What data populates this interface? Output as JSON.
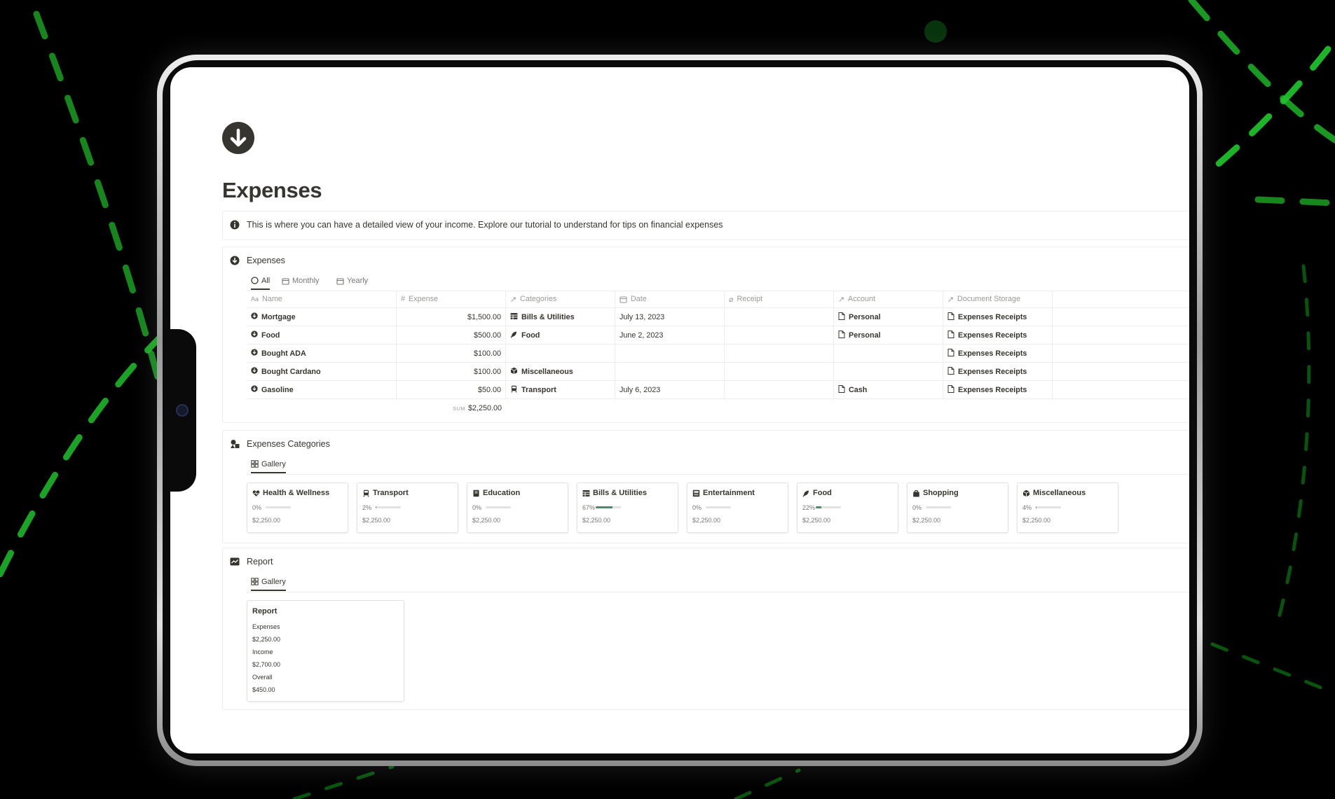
{
  "page": {
    "title": "Expenses",
    "callout_text": "This is where you can have a detailed view of your income. Explore our tutorial to understand for tips on financial expenses"
  },
  "expenses_db": {
    "title": "Expenses",
    "tabs": [
      "All",
      "Monthly",
      "Yearly"
    ],
    "active_tab": "All",
    "columns": {
      "name": "Name",
      "expense": "Expense",
      "categories": "Categories",
      "date": "Date",
      "receipt": "Receipt",
      "account": "Account",
      "document_storage": "Document Storage"
    },
    "rows": [
      {
        "name": "Mortgage",
        "expense": "$1,500.00",
        "category": "Bills & Utilities",
        "category_icon": "bills-icon",
        "date": "July 13, 2023",
        "account": "Personal",
        "doc": "Expenses Receipts"
      },
      {
        "name": "Food",
        "expense": "$500.00",
        "category": "Food",
        "category_icon": "food-icon",
        "date": "June 2, 2023",
        "account": "Personal",
        "doc": "Expenses Receipts"
      },
      {
        "name": "Bought ADA",
        "expense": "$100.00",
        "category": "",
        "category_icon": "",
        "date": "",
        "account": "",
        "doc": "Expenses Receipts"
      },
      {
        "name": "Bought Cardano",
        "expense": "$100.00",
        "category": "Miscellaneous",
        "category_icon": "misc-icon",
        "date": "",
        "account": "",
        "doc": "Expenses Receipts"
      },
      {
        "name": "Gasoline",
        "expense": "$50.00",
        "category": "Transport",
        "category_icon": "transport-icon",
        "date": "July 6, 2023",
        "account": "Cash",
        "doc": "Expenses Receipts"
      }
    ],
    "sum_label": "SUM",
    "sum_value": "$2,250.00"
  },
  "categories_db": {
    "title": "Expenses Categories",
    "view_label": "Gallery",
    "cards": [
      {
        "name": "Health & Wellness",
        "icon": "heart-icon",
        "percent_label": "0%",
        "percent": 0,
        "amount": "$2,250.00"
      },
      {
        "name": "Transport",
        "icon": "transport-icon",
        "percent_label": "2%",
        "percent": 2,
        "amount": "$2,250.00"
      },
      {
        "name": "Education",
        "icon": "book-icon",
        "percent_label": "0%",
        "percent": 0,
        "amount": "$2,250.00"
      },
      {
        "name": "Bills & Utilities",
        "icon": "bills-icon",
        "percent_label": "67%",
        "percent": 67,
        "amount": "$2,250.00"
      },
      {
        "name": "Entertainment",
        "icon": "ticket-icon",
        "percent_label": "0%",
        "percent": 0,
        "amount": "$2,250.00"
      },
      {
        "name": "Food",
        "icon": "food-icon",
        "percent_label": "22%",
        "percent": 22,
        "amount": "$2,250.00"
      },
      {
        "name": "Shopping",
        "icon": "bag-icon",
        "percent_label": "0%",
        "percent": 0,
        "amount": "$2,250.00"
      },
      {
        "name": "Miscellaneous",
        "icon": "misc-icon",
        "percent_label": "4%",
        "percent": 4,
        "amount": "$2,250.00"
      }
    ]
  },
  "report_db": {
    "title": "Report",
    "view_label": "Gallery",
    "card": {
      "title": "Report",
      "expenses_label": "Expenses",
      "expenses_value": "$2,250.00",
      "income_label": "Income",
      "income_value": "$2,700.00",
      "overall_label": "Overall",
      "overall_value": "$450.00"
    }
  },
  "colors": {
    "text": "#37352f",
    "muted": "#9b9a97",
    "border": "#ededeb",
    "progress": "#4f8a6e",
    "backdrop": "#000000",
    "accent_green": "#1fd12c"
  }
}
